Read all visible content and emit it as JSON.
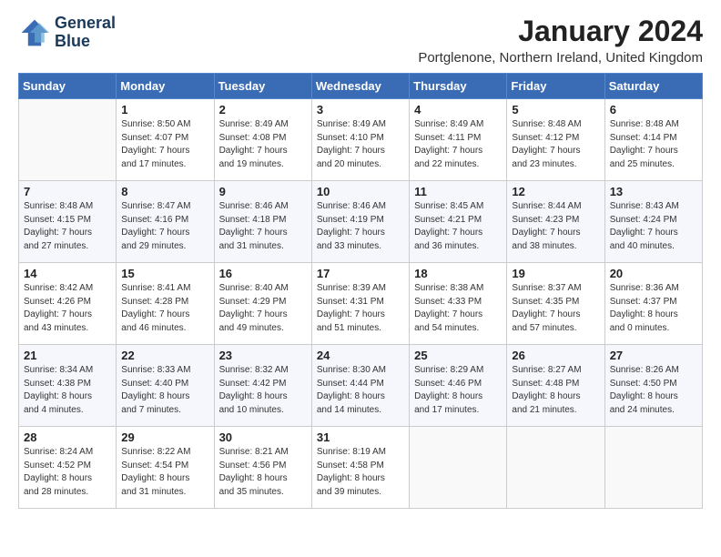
{
  "logo": {
    "line1": "General",
    "line2": "Blue"
  },
  "title": "January 2024",
  "subtitle": "Portglenone, Northern Ireland, United Kingdom",
  "days_header": [
    "Sunday",
    "Monday",
    "Tuesday",
    "Wednesday",
    "Thursday",
    "Friday",
    "Saturday"
  ],
  "weeks": [
    [
      {
        "day": "",
        "info": ""
      },
      {
        "day": "1",
        "info": "Sunrise: 8:50 AM\nSunset: 4:07 PM\nDaylight: 7 hours\nand 17 minutes."
      },
      {
        "day": "2",
        "info": "Sunrise: 8:49 AM\nSunset: 4:08 PM\nDaylight: 7 hours\nand 19 minutes."
      },
      {
        "day": "3",
        "info": "Sunrise: 8:49 AM\nSunset: 4:10 PM\nDaylight: 7 hours\nand 20 minutes."
      },
      {
        "day": "4",
        "info": "Sunrise: 8:49 AM\nSunset: 4:11 PM\nDaylight: 7 hours\nand 22 minutes."
      },
      {
        "day": "5",
        "info": "Sunrise: 8:48 AM\nSunset: 4:12 PM\nDaylight: 7 hours\nand 23 minutes."
      },
      {
        "day": "6",
        "info": "Sunrise: 8:48 AM\nSunset: 4:14 PM\nDaylight: 7 hours\nand 25 minutes."
      }
    ],
    [
      {
        "day": "7",
        "info": "Sunrise: 8:48 AM\nSunset: 4:15 PM\nDaylight: 7 hours\nand 27 minutes."
      },
      {
        "day": "8",
        "info": "Sunrise: 8:47 AM\nSunset: 4:16 PM\nDaylight: 7 hours\nand 29 minutes."
      },
      {
        "day": "9",
        "info": "Sunrise: 8:46 AM\nSunset: 4:18 PM\nDaylight: 7 hours\nand 31 minutes."
      },
      {
        "day": "10",
        "info": "Sunrise: 8:46 AM\nSunset: 4:19 PM\nDaylight: 7 hours\nand 33 minutes."
      },
      {
        "day": "11",
        "info": "Sunrise: 8:45 AM\nSunset: 4:21 PM\nDaylight: 7 hours\nand 36 minutes."
      },
      {
        "day": "12",
        "info": "Sunrise: 8:44 AM\nSunset: 4:23 PM\nDaylight: 7 hours\nand 38 minutes."
      },
      {
        "day": "13",
        "info": "Sunrise: 8:43 AM\nSunset: 4:24 PM\nDaylight: 7 hours\nand 40 minutes."
      }
    ],
    [
      {
        "day": "14",
        "info": "Sunrise: 8:42 AM\nSunset: 4:26 PM\nDaylight: 7 hours\nand 43 minutes."
      },
      {
        "day": "15",
        "info": "Sunrise: 8:41 AM\nSunset: 4:28 PM\nDaylight: 7 hours\nand 46 minutes."
      },
      {
        "day": "16",
        "info": "Sunrise: 8:40 AM\nSunset: 4:29 PM\nDaylight: 7 hours\nand 49 minutes."
      },
      {
        "day": "17",
        "info": "Sunrise: 8:39 AM\nSunset: 4:31 PM\nDaylight: 7 hours\nand 51 minutes."
      },
      {
        "day": "18",
        "info": "Sunrise: 8:38 AM\nSunset: 4:33 PM\nDaylight: 7 hours\nand 54 minutes."
      },
      {
        "day": "19",
        "info": "Sunrise: 8:37 AM\nSunset: 4:35 PM\nDaylight: 7 hours\nand 57 minutes."
      },
      {
        "day": "20",
        "info": "Sunrise: 8:36 AM\nSunset: 4:37 PM\nDaylight: 8 hours\nand 0 minutes."
      }
    ],
    [
      {
        "day": "21",
        "info": "Sunrise: 8:34 AM\nSunset: 4:38 PM\nDaylight: 8 hours\nand 4 minutes."
      },
      {
        "day": "22",
        "info": "Sunrise: 8:33 AM\nSunset: 4:40 PM\nDaylight: 8 hours\nand 7 minutes."
      },
      {
        "day": "23",
        "info": "Sunrise: 8:32 AM\nSunset: 4:42 PM\nDaylight: 8 hours\nand 10 minutes."
      },
      {
        "day": "24",
        "info": "Sunrise: 8:30 AM\nSunset: 4:44 PM\nDaylight: 8 hours\nand 14 minutes."
      },
      {
        "day": "25",
        "info": "Sunrise: 8:29 AM\nSunset: 4:46 PM\nDaylight: 8 hours\nand 17 minutes."
      },
      {
        "day": "26",
        "info": "Sunrise: 8:27 AM\nSunset: 4:48 PM\nDaylight: 8 hours\nand 21 minutes."
      },
      {
        "day": "27",
        "info": "Sunrise: 8:26 AM\nSunset: 4:50 PM\nDaylight: 8 hours\nand 24 minutes."
      }
    ],
    [
      {
        "day": "28",
        "info": "Sunrise: 8:24 AM\nSunset: 4:52 PM\nDaylight: 8 hours\nand 28 minutes."
      },
      {
        "day": "29",
        "info": "Sunrise: 8:22 AM\nSunset: 4:54 PM\nDaylight: 8 hours\nand 31 minutes."
      },
      {
        "day": "30",
        "info": "Sunrise: 8:21 AM\nSunset: 4:56 PM\nDaylight: 8 hours\nand 35 minutes."
      },
      {
        "day": "31",
        "info": "Sunrise: 8:19 AM\nSunset: 4:58 PM\nDaylight: 8 hours\nand 39 minutes."
      },
      {
        "day": "",
        "info": ""
      },
      {
        "day": "",
        "info": ""
      },
      {
        "day": "",
        "info": ""
      }
    ]
  ]
}
